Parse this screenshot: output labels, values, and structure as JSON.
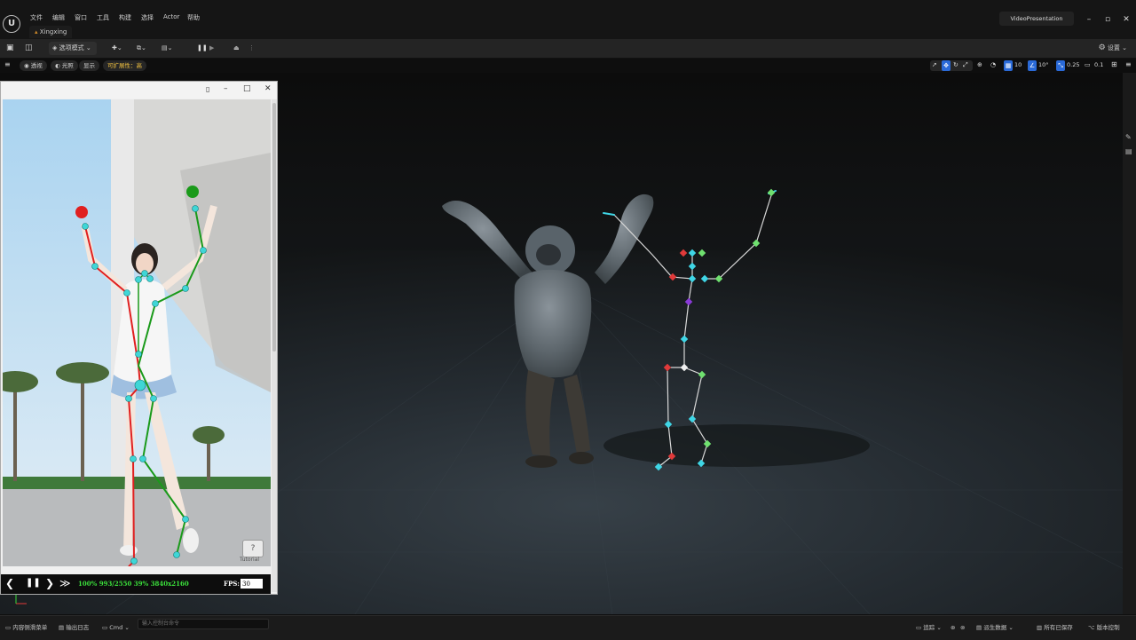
{
  "app": {
    "logo_text": "U",
    "level_tab": "Xingxing",
    "project": "VideoPresentation"
  },
  "menu": [
    "文件",
    "编辑",
    "窗口",
    "工具",
    "构建",
    "选择",
    "Actor",
    "帮助"
  ],
  "toolbar": {
    "mode_label": "选项模式",
    "settings_label": "设置"
  },
  "viewport_bar": {
    "perspective": "透视",
    "lit": "光照",
    "show": "显示",
    "scalability": "可扩展性：高",
    "grid_size": "10",
    "rotation_snap": "10°",
    "scale_snap": "0.25",
    "camera_speed": "0.1"
  },
  "float_window": {
    "tutorial": "Tutorial",
    "tutorial_icon": "?",
    "status": "100% 993/2550 39% 3840x2160",
    "fps_label": "FPS:",
    "fps_value": "30"
  },
  "status_bar": {
    "content_drawer": "内容侧滑菜单",
    "output_log": "输出日志",
    "cmd": "Cmd",
    "cmd_placeholder": "输入控制台命令",
    "trace": "追踪",
    "derived_data": "派生数据",
    "all_saved": "所有已保存",
    "source_control": "版本控制"
  },
  "colors": {
    "left_limb": "#e02020",
    "right_limb": "#1a9a1a",
    "joint": "#3fd6d6",
    "viewport_bg": "#1c2024",
    "accent_blue": "#2a6ad8"
  }
}
